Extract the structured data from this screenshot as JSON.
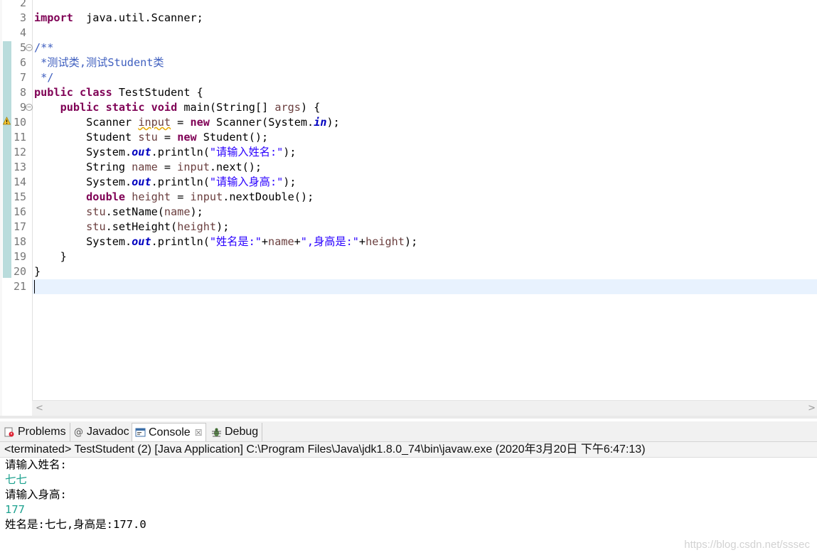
{
  "editor": {
    "lines": [
      {
        "num": "2",
        "parts": []
      },
      {
        "num": "3",
        "parts": [
          [
            "kw",
            "import"
          ],
          [
            "",
            "  java.util.Scanner;"
          ]
        ]
      },
      {
        "num": "4",
        "parts": []
      },
      {
        "num": "5",
        "fold": true,
        "parts": [
          [
            "cm",
            "/**"
          ]
        ]
      },
      {
        "num": "6",
        "parts": [
          [
            "cm",
            " *测试类,测试Student类"
          ]
        ]
      },
      {
        "num": "7",
        "parts": [
          [
            "cm",
            " */"
          ]
        ]
      },
      {
        "num": "8",
        "parts": [
          [
            "kw",
            "public"
          ],
          [
            "",
            " "
          ],
          [
            "kw",
            "class"
          ],
          [
            "",
            " TestStudent {"
          ]
        ]
      },
      {
        "num": "9",
        "fold": true,
        "parts": [
          [
            "",
            "    "
          ],
          [
            "kw",
            "public"
          ],
          [
            "",
            " "
          ],
          [
            "kw",
            "static"
          ],
          [
            "",
            " "
          ],
          [
            "kw",
            "void"
          ],
          [
            "",
            " main(String[] "
          ],
          [
            "var",
            "args"
          ],
          [
            "",
            ") {"
          ]
        ]
      },
      {
        "num": "10",
        "parts": [
          [
            "",
            "        Scanner "
          ],
          [
            "var warn",
            "input"
          ],
          [
            "",
            " = "
          ],
          [
            "kw",
            "new"
          ],
          [
            "",
            " Scanner(System."
          ],
          [
            "fld",
            "in"
          ],
          [
            "",
            ");"
          ]
        ]
      },
      {
        "num": "11",
        "parts": [
          [
            "",
            "        Student "
          ],
          [
            "var",
            "stu"
          ],
          [
            "",
            " = "
          ],
          [
            "kw",
            "new"
          ],
          [
            "",
            " Student();"
          ]
        ]
      },
      {
        "num": "12",
        "parts": [
          [
            "",
            "        System."
          ],
          [
            "fld",
            "out"
          ],
          [
            "",
            ".println("
          ],
          [
            "st",
            "\"请输入姓名:\""
          ],
          [
            "",
            ");"
          ]
        ]
      },
      {
        "num": "13",
        "parts": [
          [
            "",
            "        String "
          ],
          [
            "var",
            "name"
          ],
          [
            "",
            " = "
          ],
          [
            "var",
            "input"
          ],
          [
            "",
            ".next();"
          ]
        ]
      },
      {
        "num": "14",
        "parts": [
          [
            "",
            "        System."
          ],
          [
            "fld",
            "out"
          ],
          [
            "",
            ".println("
          ],
          [
            "st",
            "\"请输入身高:\""
          ],
          [
            "",
            ");"
          ]
        ]
      },
      {
        "num": "15",
        "parts": [
          [
            "",
            "        "
          ],
          [
            "kw",
            "double"
          ],
          [
            "",
            " "
          ],
          [
            "var",
            "height"
          ],
          [
            "",
            " = "
          ],
          [
            "var",
            "input"
          ],
          [
            "",
            ".nextDouble();"
          ]
        ]
      },
      {
        "num": "16",
        "parts": [
          [
            "",
            "        "
          ],
          [
            "var",
            "stu"
          ],
          [
            "",
            ".setName("
          ],
          [
            "var",
            "name"
          ],
          [
            "",
            ");"
          ]
        ]
      },
      {
        "num": "17",
        "parts": [
          [
            "",
            "        "
          ],
          [
            "var",
            "stu"
          ],
          [
            "",
            ".setHeight("
          ],
          [
            "var",
            "height"
          ],
          [
            "",
            ");"
          ]
        ]
      },
      {
        "num": "18",
        "parts": [
          [
            "",
            "        System."
          ],
          [
            "fld",
            "out"
          ],
          [
            "",
            ".println("
          ],
          [
            "st",
            "\"姓名是:\""
          ],
          [
            "",
            "+"
          ],
          [
            "var",
            "name"
          ],
          [
            "",
            "+"
          ],
          [
            "st",
            "\",身高是:\""
          ],
          [
            "",
            "+"
          ],
          [
            "var",
            "height"
          ],
          [
            "",
            ");"
          ]
        ]
      },
      {
        "num": "19",
        "parts": [
          [
            "",
            "    }"
          ]
        ]
      },
      {
        "num": "20",
        "parts": [
          [
            "",
            "}"
          ]
        ]
      },
      {
        "num": "21",
        "parts": []
      }
    ]
  },
  "views": {
    "tabs": [
      {
        "label": "Problems",
        "icon": "problems-icon"
      },
      {
        "label": "Javadoc",
        "icon": "at-icon",
        "glyph": "@"
      },
      {
        "label": "Console",
        "icon": "console-icon",
        "active": true,
        "close": "☒"
      },
      {
        "label": "Debug",
        "icon": "bug-icon"
      }
    ],
    "console_description": "<terminated> TestStudent (2) [Java Application] C:\\Program Files\\Java\\jdk1.8.0_74\\bin\\javaw.exe (2020年3月20日 下午6:47:13)",
    "console_lines": [
      {
        "text": "请输入姓名:",
        "input": false
      },
      {
        "text": "七七",
        "input": true
      },
      {
        "text": "请输入身高:",
        "input": false
      },
      {
        "text": "177",
        "input": true
      },
      {
        "text": "姓名是:七七,身高是:177.0",
        "input": false
      }
    ]
  },
  "watermark": "https://blog.csdn.net/sssec",
  "colors": {
    "keyword": "#7f0055",
    "comment": "#3f5fbf",
    "string": "#2a00ff",
    "field": "#0000c0",
    "variable": "#6a3e3e",
    "console_input": "#1ea28f",
    "current_line": "#e8f2fe"
  }
}
